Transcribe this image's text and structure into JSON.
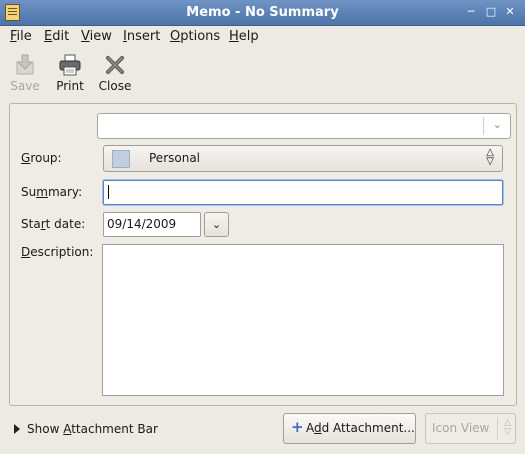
{
  "window": {
    "title": "Memo - No Summary",
    "controls": [
      "minimize-icon",
      "maximize-icon",
      "close-icon"
    ]
  },
  "menubar": {
    "items": [
      {
        "label": "File",
        "mnemonic": "F"
      },
      {
        "label": "Edit",
        "mnemonic": "E"
      },
      {
        "label": "View",
        "mnemonic": "V"
      },
      {
        "label": "Insert",
        "mnemonic": "I"
      },
      {
        "label": "Options",
        "mnemonic": "O"
      },
      {
        "label": "Help",
        "mnemonic": "H"
      }
    ]
  },
  "toolbar": {
    "save_label": "Save",
    "save_enabled": false,
    "print_label": "Print",
    "close_label": "Close"
  },
  "form": {
    "category_combo_value": "",
    "group_label": "Group:",
    "group_value": "Personal",
    "group_color": "#bfcfe0",
    "summary_label": "Summary:",
    "summary_value": "",
    "start_date_label": "Start date:",
    "start_date_value": "09/14/2009",
    "description_label": "Description:",
    "description_value": ""
  },
  "bottom": {
    "show_attachment_bar_label": "Show Attachment Bar",
    "add_attachment_label": "Add Attachment...",
    "icon_view_label": "Icon View",
    "icon_view_enabled": false
  },
  "colors": {
    "titlebar": "#5a7fb4",
    "focus_border": "#5a86c0",
    "window_bg": "#ede9e3"
  }
}
